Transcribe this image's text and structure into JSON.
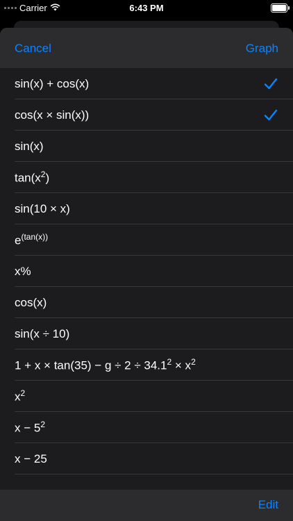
{
  "status": {
    "carrier": "Carrier",
    "time": "6:43 PM"
  },
  "nav": {
    "cancel_label": "Cancel",
    "graph_label": "Graph"
  },
  "functions": [
    {
      "parts": [
        {
          "t": "sin(x) + cos(x)"
        }
      ],
      "checked": true
    },
    {
      "parts": [
        {
          "t": "cos(x × sin(x))"
        }
      ],
      "checked": true
    },
    {
      "parts": [
        {
          "t": "sin(x)"
        }
      ],
      "checked": false
    },
    {
      "parts": [
        {
          "t": "tan(x"
        },
        {
          "sup": "2"
        },
        {
          "t": ")"
        }
      ],
      "checked": false
    },
    {
      "parts": [
        {
          "t": "sin(10 × x)"
        }
      ],
      "checked": false
    },
    {
      "parts": [
        {
          "t": "e"
        },
        {
          "sup": "(tan(x))"
        }
      ],
      "checked": false
    },
    {
      "parts": [
        {
          "t": "x%"
        }
      ],
      "checked": false
    },
    {
      "parts": [
        {
          "t": "cos(x)"
        }
      ],
      "checked": false
    },
    {
      "parts": [
        {
          "t": "sin(x ÷ 10)"
        }
      ],
      "checked": false
    },
    {
      "parts": [
        {
          "t": "1 + x × tan(35) − g ÷ 2 ÷ 34.1"
        },
        {
          "sup": "2"
        },
        {
          "t": " × x"
        },
        {
          "sup": "2"
        }
      ],
      "checked": false
    },
    {
      "parts": [
        {
          "t": "x"
        },
        {
          "sup": "2"
        }
      ],
      "checked": false
    },
    {
      "parts": [
        {
          "t": "x − 5"
        },
        {
          "sup": "2"
        }
      ],
      "checked": false
    },
    {
      "parts": [
        {
          "t": "x − 25"
        }
      ],
      "checked": false
    }
  ],
  "toolbar": {
    "edit_label": "Edit"
  },
  "colors": {
    "accent": "#0a84ff",
    "sheet": "#1c1c1e",
    "bar": "#2c2c2e",
    "separator": "#38383a"
  }
}
